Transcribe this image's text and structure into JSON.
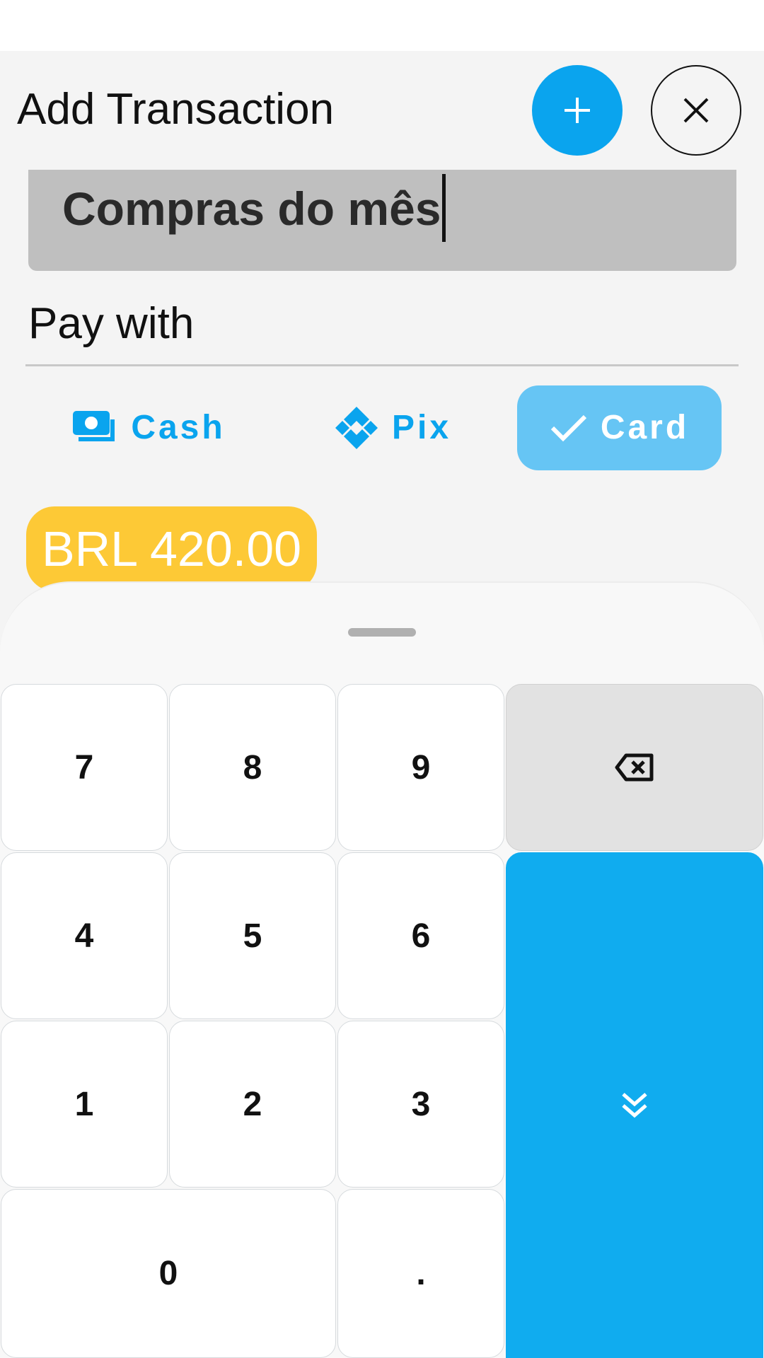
{
  "header": {
    "title": "Add Transaction",
    "add_icon": "plus-icon",
    "close_icon": "close-icon"
  },
  "description": {
    "value": "Compras do mês"
  },
  "payment": {
    "label": "Pay with",
    "options": [
      {
        "label": "Cash",
        "icon": "cash-icon",
        "selected": false
      },
      {
        "label": "Pix",
        "icon": "pix-icon",
        "selected": false
      },
      {
        "label": "Card",
        "icon": "check-icon",
        "selected": true
      }
    ]
  },
  "amount": {
    "text": "BRL 420.00"
  },
  "keypad": {
    "keys": {
      "k7": "7",
      "k8": "8",
      "k9": "9",
      "k4": "4",
      "k5": "5",
      "k6": "6",
      "k1": "1",
      "k2": "2",
      "k3": "3",
      "k0": "0",
      "dot": "."
    },
    "backspace_icon": "backspace-icon",
    "done_icon": "chevron-double-down-icon"
  },
  "colors": {
    "primary": "#0aa4ee",
    "selected_chip": "#66c5f4",
    "amount_badge": "#fdc936",
    "done_key": "#10acef",
    "description_bg": "#bfbfbf"
  }
}
